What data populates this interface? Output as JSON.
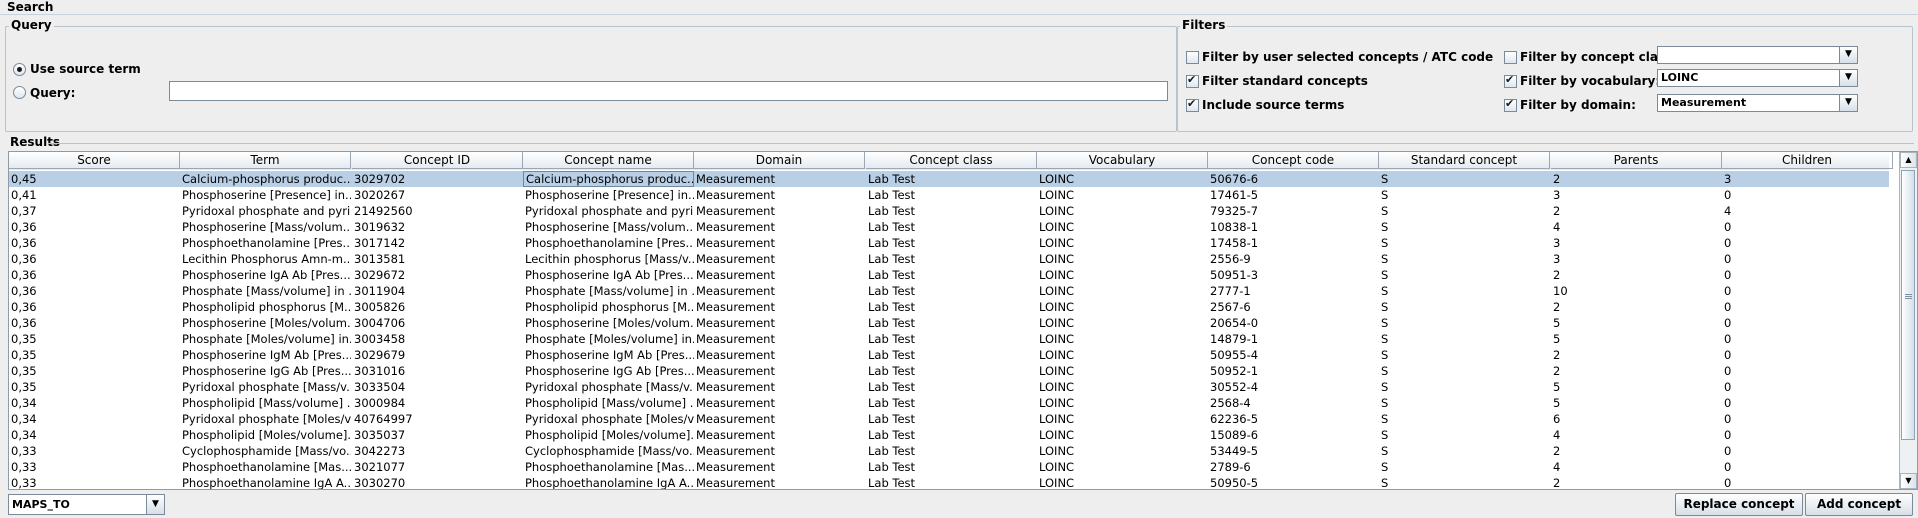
{
  "search_title": "Search",
  "query": {
    "title": "Query",
    "use_source_term_label": "Use source term",
    "query_label": "Query:",
    "query_value": "",
    "use_source_term_selected": true
  },
  "filters": {
    "title": "Filters",
    "by_user_selected": {
      "label": "Filter by user selected concepts / ATC code",
      "checked": false
    },
    "standard_concepts": {
      "label": "Filter standard concepts",
      "checked": true
    },
    "include_source_terms": {
      "label": "Include source terms",
      "checked": true
    },
    "by_concept_class": {
      "label": "Filter by concept class:",
      "checked": false,
      "value": ""
    },
    "by_vocabulary": {
      "label": "Filter by vocabulary:",
      "checked": true,
      "value": "LOINC"
    },
    "by_domain": {
      "label": "Filter by domain:",
      "checked": true,
      "value": "Measurement"
    }
  },
  "results": {
    "title": "Results",
    "columns": [
      "Score",
      "Term",
      "Concept ID",
      "Concept name",
      "Domain",
      "Concept class",
      "Vocabulary",
      "Concept code",
      "Standard concept",
      "Parents",
      "Children"
    ],
    "rows": [
      [
        "0,45",
        "Calcium-phosphorus produc...",
        "3029702",
        "Calcium-phosphorus produc...",
        "Measurement",
        "Lab Test",
        "LOINC",
        "50676-6",
        "S",
        "2",
        "3"
      ],
      [
        "0,41",
        "Phosphoserine [Presence] in...",
        "3020267",
        "Phosphoserine [Presence] in...",
        "Measurement",
        "Lab Test",
        "LOINC",
        "17461-5",
        "S",
        "3",
        "0"
      ],
      [
        "0,37",
        "Pyridoxal phosphate and pyri...",
        "21492560",
        "Pyridoxal phosphate and pyri...",
        "Measurement",
        "Lab Test",
        "LOINC",
        "79325-7",
        "S",
        "2",
        "4"
      ],
      [
        "0,36",
        "Phosphoserine [Mass/volum...",
        "3019632",
        "Phosphoserine [Mass/volum...",
        "Measurement",
        "Lab Test",
        "LOINC",
        "10838-1",
        "S",
        "4",
        "0"
      ],
      [
        "0,36",
        "Phosphoethanolamine [Pres...",
        "3017142",
        "Phosphoethanolamine [Pres...",
        "Measurement",
        "Lab Test",
        "LOINC",
        "17458-1",
        "S",
        "3",
        "0"
      ],
      [
        "0,36",
        "Lecithin Phosphorus Amn-m...",
        "3013581",
        "Lecithin phosphorus [Mass/v...",
        "Measurement",
        "Lab Test",
        "LOINC",
        "2556-9",
        "S",
        "3",
        "0"
      ],
      [
        "0,36",
        "Phosphoserine IgA Ab [Pres...",
        "3029672",
        "Phosphoserine IgA Ab [Pres...",
        "Measurement",
        "Lab Test",
        "LOINC",
        "50951-3",
        "S",
        "2",
        "0"
      ],
      [
        "0,36",
        "Phosphate [Mass/volume] in ...",
        "3011904",
        "Phosphate [Mass/volume] in ...",
        "Measurement",
        "Lab Test",
        "LOINC",
        "2777-1",
        "S",
        "10",
        "0"
      ],
      [
        "0,36",
        "Phospholipid phosphorus [M...",
        "3005826",
        "Phospholipid phosphorus [M...",
        "Measurement",
        "Lab Test",
        "LOINC",
        "2567-6",
        "S",
        "2",
        "0"
      ],
      [
        "0,36",
        "Phosphoserine [Moles/volum...",
        "3004706",
        "Phosphoserine [Moles/volum...",
        "Measurement",
        "Lab Test",
        "LOINC",
        "20654-0",
        "S",
        "5",
        "0"
      ],
      [
        "0,35",
        "Phosphate [Moles/volume] in...",
        "3003458",
        "Phosphate [Moles/volume] in...",
        "Measurement",
        "Lab Test",
        "LOINC",
        "14879-1",
        "S",
        "5",
        "0"
      ],
      [
        "0,35",
        "Phosphoserine IgM Ab [Pres...",
        "3029679",
        "Phosphoserine IgM Ab [Pres...",
        "Measurement",
        "Lab Test",
        "LOINC",
        "50955-4",
        "S",
        "2",
        "0"
      ],
      [
        "0,35",
        "Phosphoserine IgG Ab [Pres...",
        "3031016",
        "Phosphoserine IgG Ab [Pres...",
        "Measurement",
        "Lab Test",
        "LOINC",
        "50952-1",
        "S",
        "2",
        "0"
      ],
      [
        "0,35",
        "Pyridoxal phosphate [Mass/v...",
        "3033504",
        "Pyridoxal phosphate [Mass/v...",
        "Measurement",
        "Lab Test",
        "LOINC",
        "30552-4",
        "S",
        "5",
        "0"
      ],
      [
        "0,34",
        "Phospholipid [Mass/volume] ...",
        "3000984",
        "Phospholipid [Mass/volume] ...",
        "Measurement",
        "Lab Test",
        "LOINC",
        "2568-4",
        "S",
        "5",
        "0"
      ],
      [
        "0,34",
        "Pyridoxal phosphate [Moles/v...",
        "40764997",
        "Pyridoxal phosphate [Moles/v...",
        "Measurement",
        "Lab Test",
        "LOINC",
        "62236-5",
        "S",
        "6",
        "0"
      ],
      [
        "0,34",
        "Phospholipid [Moles/volume]...",
        "3035037",
        "Phospholipid [Moles/volume]...",
        "Measurement",
        "Lab Test",
        "LOINC",
        "15089-6",
        "S",
        "4",
        "0"
      ],
      [
        "0,33",
        "Cyclophosphamide [Mass/vo...",
        "3042273",
        "Cyclophosphamide [Mass/vo...",
        "Measurement",
        "Lab Test",
        "LOINC",
        "53449-5",
        "S",
        "2",
        "0"
      ],
      [
        "0,33",
        "Phosphoethanolamine [Mas...",
        "3021077",
        "Phosphoethanolamine [Mas...",
        "Measurement",
        "Lab Test",
        "LOINC",
        "2789-6",
        "S",
        "4",
        "0"
      ],
      [
        "0,33",
        "Phosphoethanolamine IgA A...",
        "3030270",
        "Phosphoethanolamine IgA A...",
        "Measurement",
        "Lab Test",
        "LOINC",
        "50950-5",
        "S",
        "2",
        "0"
      ]
    ],
    "selected_row": 0
  },
  "footer": {
    "relation_value": "MAPS_TO",
    "replace_label": "Replace concept",
    "add_label": "Add concept"
  }
}
